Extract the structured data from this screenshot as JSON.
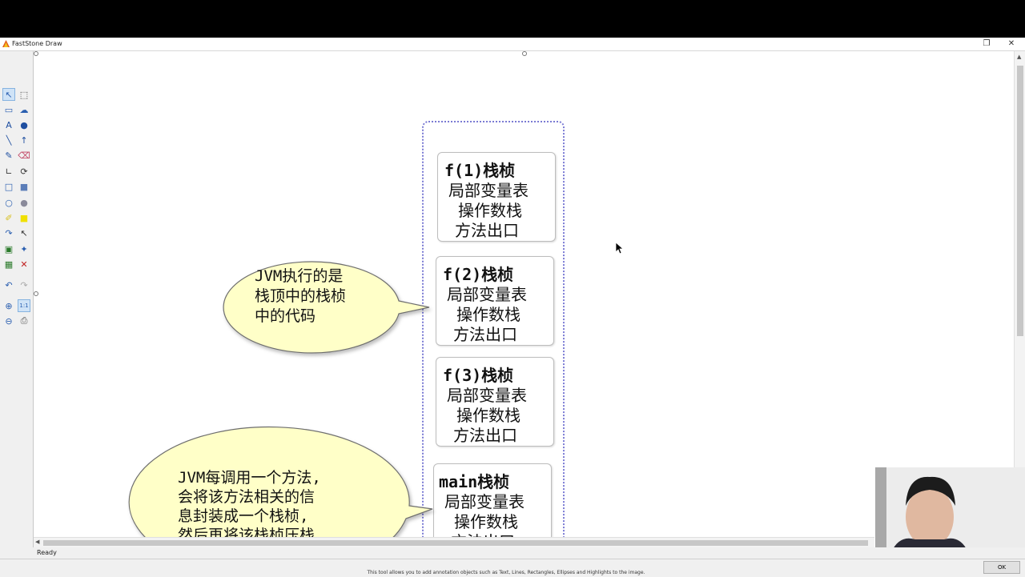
{
  "window": {
    "title": "FastStone Draw",
    "restore_icon": "restore-icon",
    "close_icon": "close-icon"
  },
  "toolbar": {
    "tools": [
      "select-arrow",
      "select-rectangle",
      "callout-rect",
      "callout-cloud",
      "text",
      "info-number",
      "line",
      "arrow",
      "pen",
      "eraser",
      "polyline",
      "lasso",
      "rectangle",
      "rectangle-filled",
      "ellipse",
      "ellipse-filled",
      "highlighter",
      "highlight-fill",
      "arrow-curved",
      "cursor",
      "image-insert",
      "watermark",
      "border",
      "delete",
      "undo",
      "redo",
      "zoom-in",
      "actual-size",
      "zoom-out",
      "print"
    ]
  },
  "diagram": {
    "frames": [
      {
        "header": "f(1)栈桢",
        "lines": [
          "局部变量表",
          "操作数栈",
          "方法出口"
        ]
      },
      {
        "header": "f(2)栈桢",
        "lines": [
          "局部变量表",
          "操作数栈",
          "方法出口"
        ]
      },
      {
        "header": "f(3)栈桢",
        "lines": [
          "局部变量表",
          "操作数栈",
          "方法出口"
        ]
      },
      {
        "header": "main栈桢",
        "lines": [
          "局部变量表",
          "操作数栈",
          "方法出口"
        ]
      }
    ],
    "callout1": [
      "JVM执行的是",
      "栈顶中的栈桢",
      "中的代码"
    ],
    "callout2": [
      "JVM每调用一个方法,",
      "会将该方法相关的信",
      "息封装成一个栈桢,",
      "然后再将该栈桢压栈"
    ]
  },
  "status": {
    "text": "Ready",
    "hint": "This tool allows you to add annotation objects such as Text, Lines, Rectangles, Ellipses and Highlights to the image.",
    "ok_label": "OK"
  },
  "colors": {
    "callout_fill": "#ffffc8",
    "frame_border": "#7b7bd4"
  }
}
